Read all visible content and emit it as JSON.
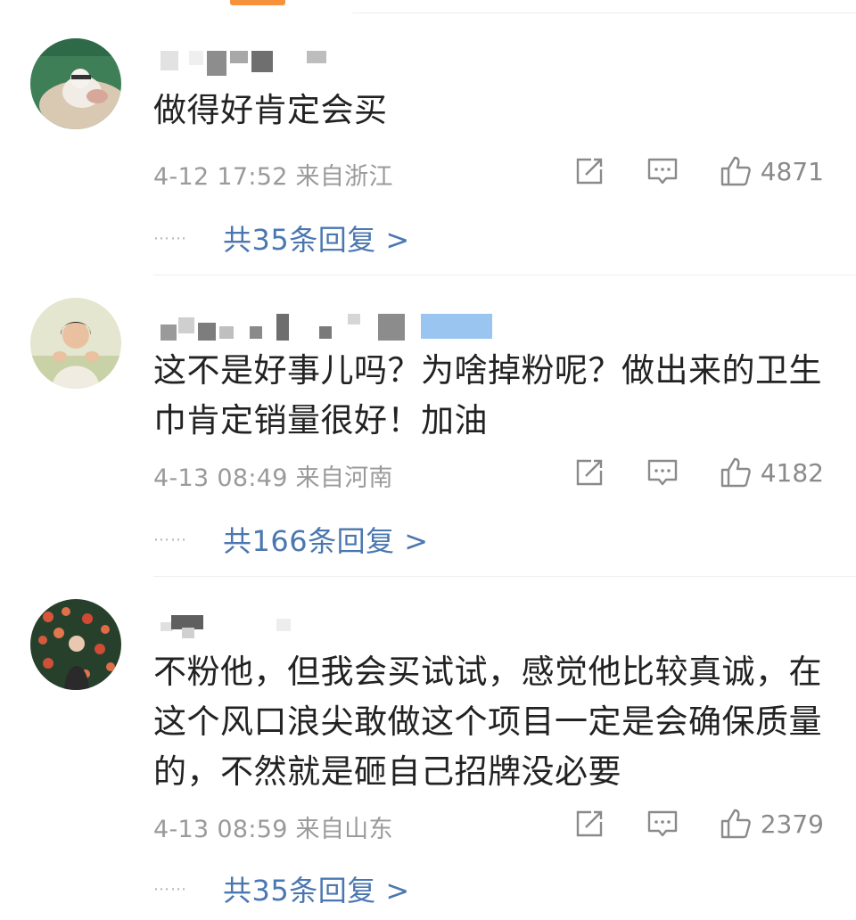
{
  "comments": [
    {
      "text": "做得好肯定会买",
      "meta": "4-12 17:52  来自浙江",
      "likes": "4871",
      "replies": "共35条回复 >"
    },
    {
      "text": "这不是好事儿吗？为啥掉粉呢？做出来的卫生巾肯定销量很好！加油",
      "meta": "4-13 08:49  来自河南",
      "likes": "4182",
      "replies": "共166条回复 >"
    },
    {
      "text": "不粉他，但我会买试试，感觉他比较真诚，在这个风口浪尖敢做这个项目一定是会确保质量的，不然就是砸自己招牌没必要",
      "meta": "4-13 08:59  来自山东",
      "likes": "2379",
      "replies": "共35条回复 >"
    }
  ],
  "ellipsis": "⋯⋯",
  "colors": {
    "link": "#4b77b0",
    "meta": "#9a9a9a",
    "accent": "#f7913b",
    "verified_badge": "#8fbfef"
  },
  "icons": [
    "share-icon",
    "comment-icon",
    "like-icon"
  ]
}
